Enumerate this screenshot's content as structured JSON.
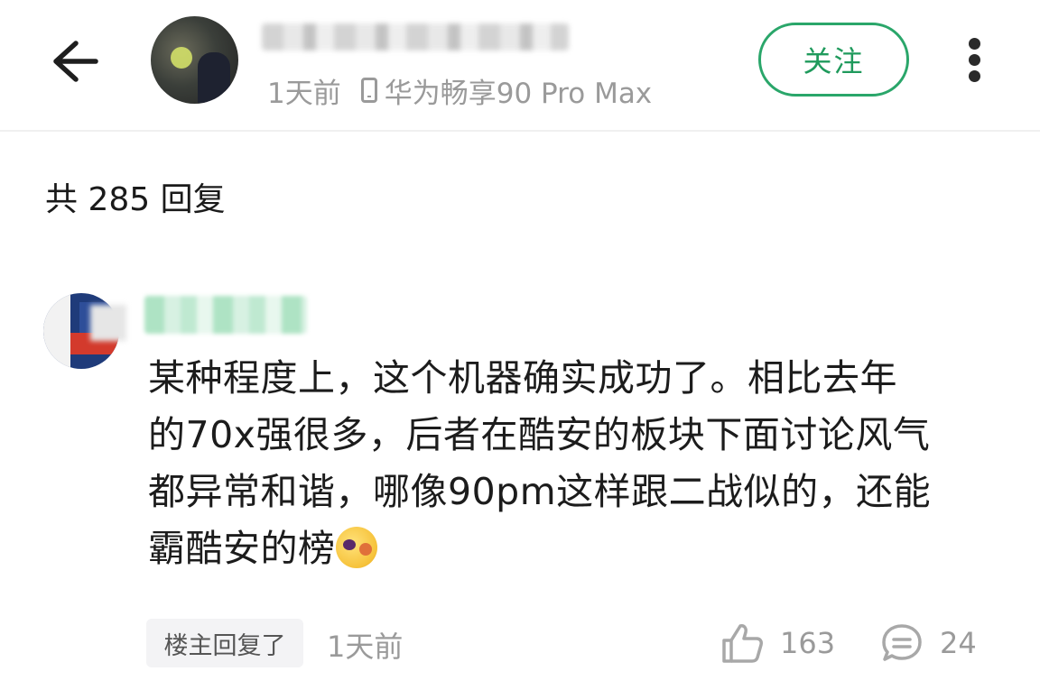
{
  "header": {
    "post_time": "1天前",
    "device": "华为畅享90 Pro Max",
    "follow_label": "关注",
    "back_icon": "back-arrow-icon",
    "more_icon": "more-vertical-icon"
  },
  "replies": {
    "count_label": "共 285 回复"
  },
  "comment": {
    "text_lines": [
      "某种程度上，这个机器确实成功了。相比去年",
      "的70x强很多，后者在酷安的板块下面讨论风气",
      "都异常和谐，哪像90pm这样跟二战似的，还能",
      "霸酷安的榜"
    ],
    "op_tag": "楼主回复了",
    "time": "1天前",
    "likes": "163",
    "reply_count": "24",
    "emoji_icon": "shocked-face-emoji"
  },
  "colors": {
    "accent_green": "#2aa66a",
    "text_gray": "#9a9a9a"
  }
}
